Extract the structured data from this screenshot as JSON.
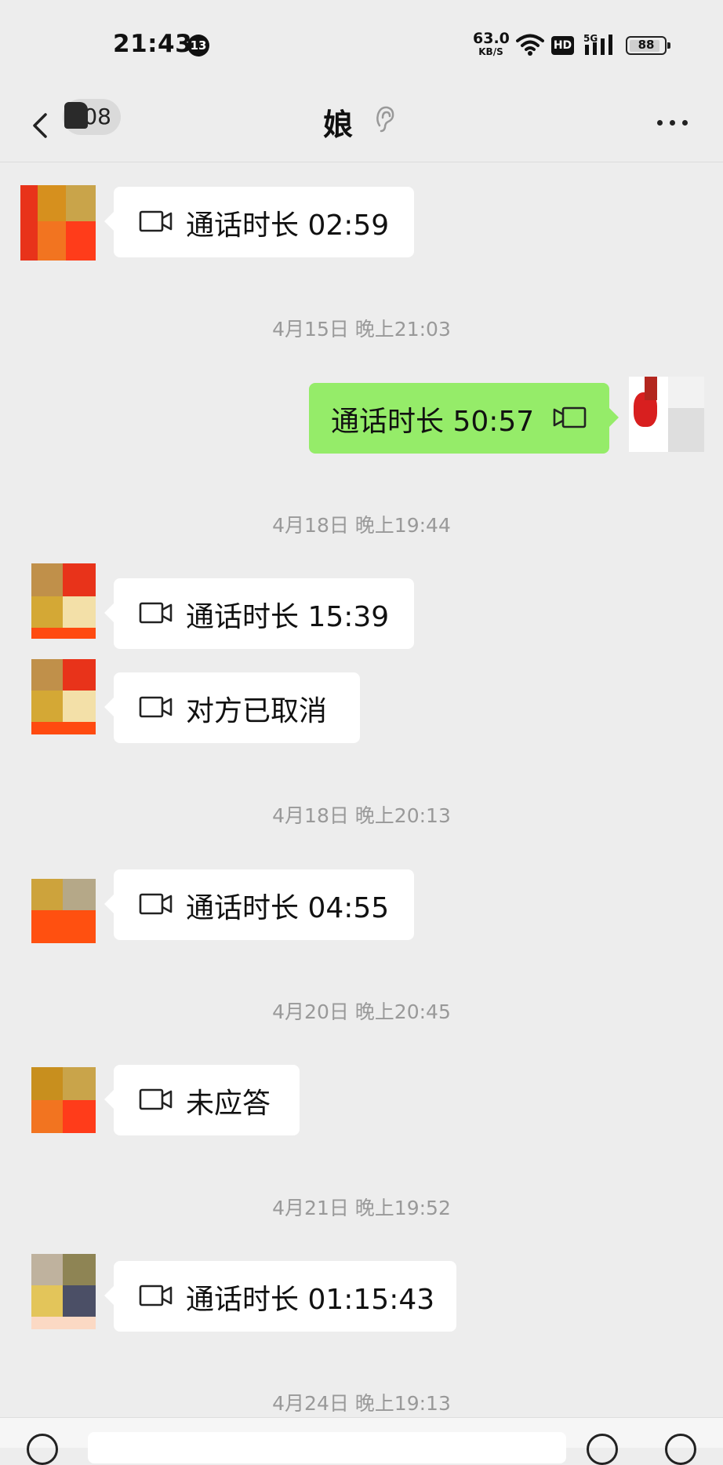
{
  "status_bar": {
    "time": "21:43",
    "notification_count": "13",
    "net_speed_value": "63.0",
    "net_speed_unit": "KB/S",
    "hd_label": "HD",
    "network_type": "5G",
    "battery_level": "88"
  },
  "header": {
    "unread_count": "08",
    "title": "娘"
  },
  "messages": [
    {
      "type": "call",
      "side": "in",
      "text": "通话时长 02:59"
    },
    {
      "type": "timestamp",
      "text": "4月15日 晚上21:03"
    },
    {
      "type": "call",
      "side": "out",
      "text": "通话时长 50:57"
    },
    {
      "type": "timestamp",
      "text": "4月18日 晚上19:44"
    },
    {
      "type": "call",
      "side": "in",
      "text": "通话时长 15:39"
    },
    {
      "type": "call",
      "side": "in",
      "text": "对方已取消"
    },
    {
      "type": "timestamp",
      "text": "4月18日 晚上20:13"
    },
    {
      "type": "call",
      "side": "in",
      "text": "通话时长 04:55"
    },
    {
      "type": "timestamp",
      "text": "4月20日 晚上20:45"
    },
    {
      "type": "call",
      "side": "in",
      "text": "未应答"
    },
    {
      "type": "timestamp",
      "text": "4月21日 晚上19:52"
    },
    {
      "type": "call",
      "side": "in",
      "text": "通话时长 01:15:43"
    },
    {
      "type": "timestamp",
      "text": "4月24日 晚上19:13"
    }
  ],
  "icons": {
    "back": "chevron-left-icon",
    "mute": "ear-icon",
    "more": "more-dots-icon",
    "call": "video-camera-icon"
  },
  "colors": {
    "background": "#ededed",
    "bubble_in": "#ffffff",
    "bubble_out": "#95ec69",
    "timestamp": "#999999"
  }
}
